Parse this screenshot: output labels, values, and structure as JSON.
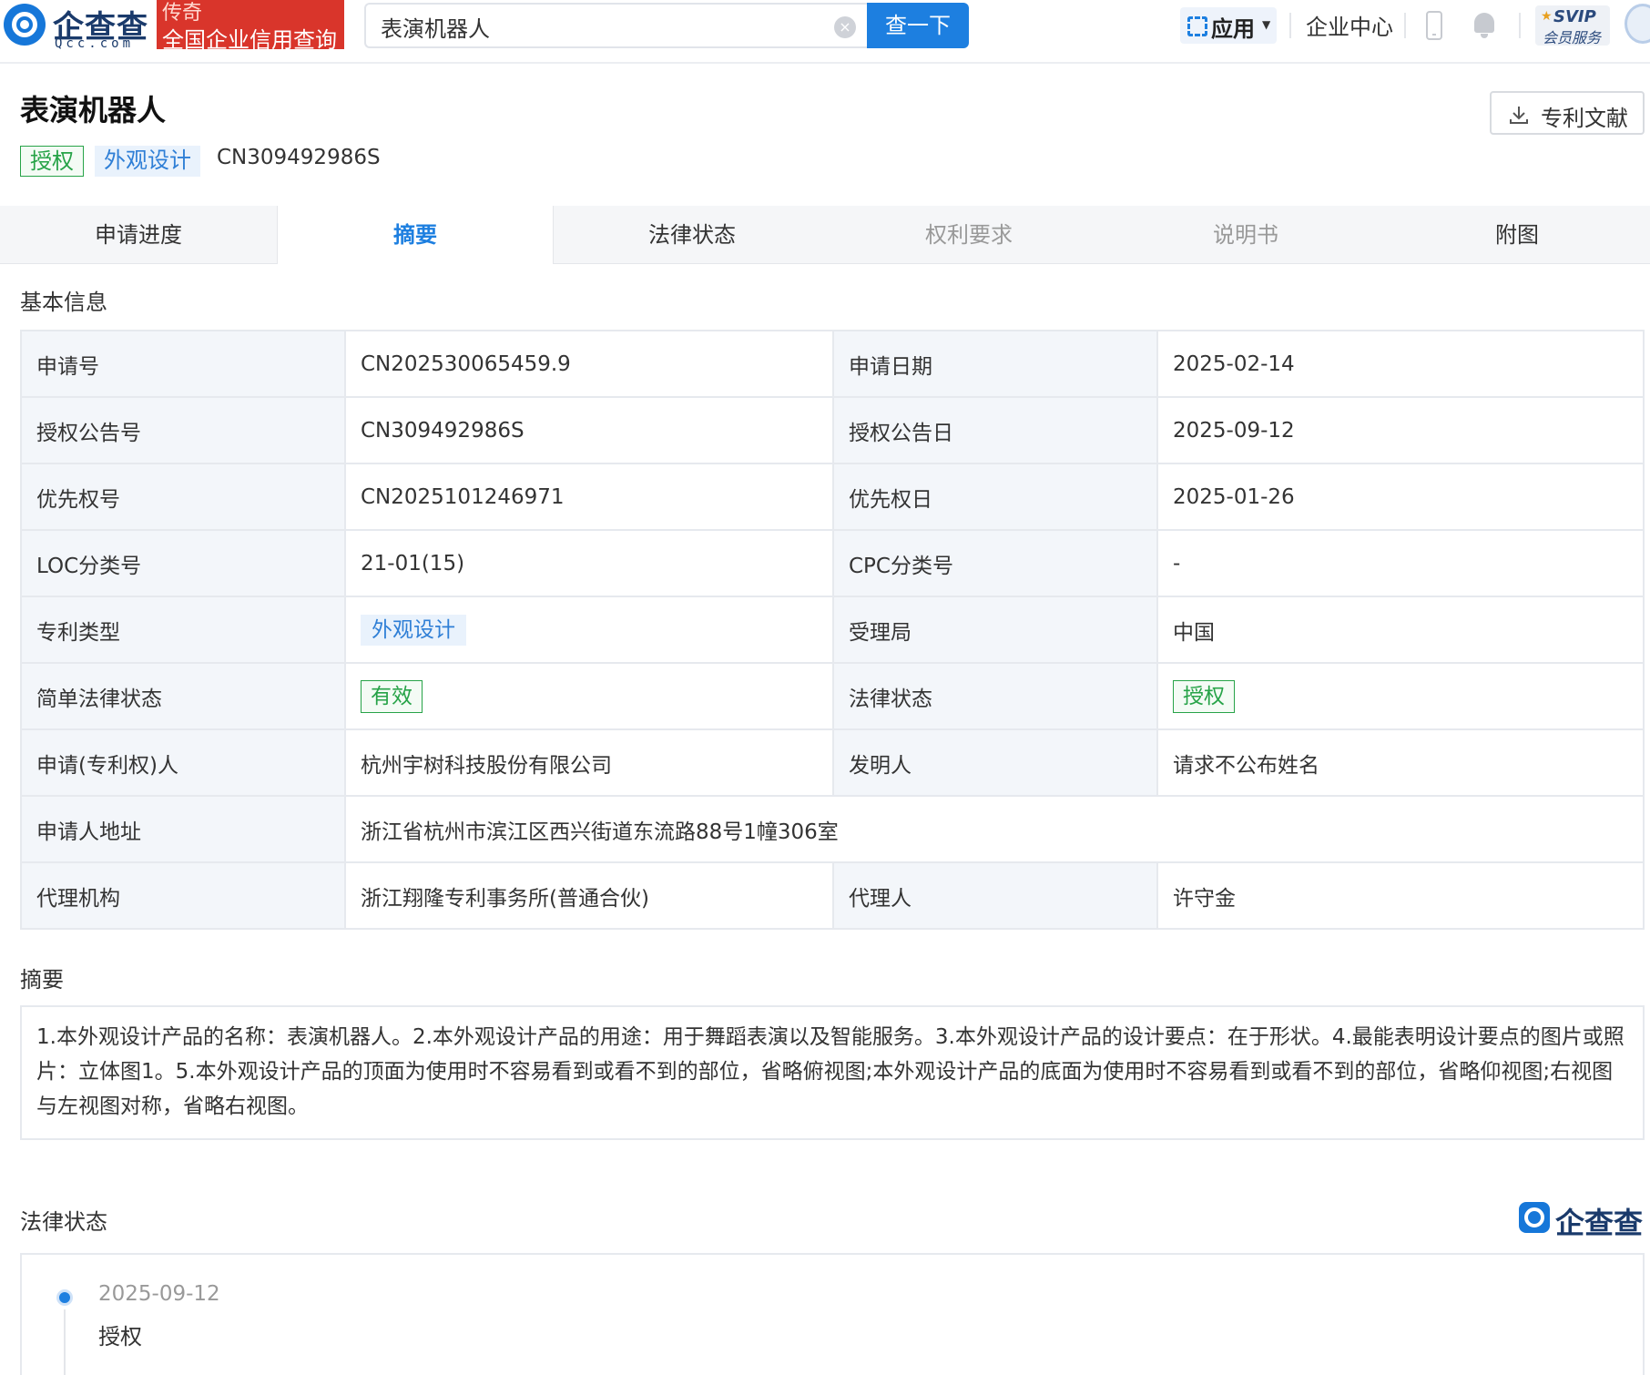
{
  "header": {
    "logo_cn": "企查查",
    "logo_en": "Qcc.com",
    "promo_line1": "传奇",
    "promo_line2": "全国企业信用查询",
    "search_value": "表演机器人",
    "search_button": "查一下",
    "apps_label": "应用",
    "enterprise_center": "企业中心",
    "svip_title": "SVIP",
    "svip_sub": "会员服务"
  },
  "patent": {
    "title": "表演机器人",
    "tags": [
      "授权",
      "外观设计"
    ],
    "publication_no": "CN309492986S",
    "doc_button": "专利文献"
  },
  "tabs": [
    {
      "label": "申请进度",
      "state": "normal"
    },
    {
      "label": "摘要",
      "state": "active"
    },
    {
      "label": "法律状态",
      "state": "normal"
    },
    {
      "label": "权利要求",
      "state": "disabled"
    },
    {
      "label": "说明书",
      "state": "disabled"
    },
    {
      "label": "附图",
      "state": "normal"
    }
  ],
  "basic_info": {
    "section_title": "基本信息",
    "rows": [
      {
        "l1": "申请号",
        "v1": "CN202530065459.9",
        "l2": "申请日期",
        "v2": "2025-02-14"
      },
      {
        "l1": "授权公告号",
        "v1": "CN309492986S",
        "l2": "授权公告日",
        "v2": "2025-09-12"
      },
      {
        "l1": "优先权号",
        "v1": "CN2025101246971",
        "l2": "优先权日",
        "v2": "2025-01-26"
      },
      {
        "l1": "LOC分类号",
        "v1": "21-01(15)",
        "l2": "CPC分类号",
        "v2": "-"
      },
      {
        "l1": "专利类型",
        "v1": "外观设计",
        "l2": "受理局",
        "v2": "中国"
      },
      {
        "l1": "简单法律状态",
        "v1": "有效",
        "l2": "法律状态",
        "v2": "授权"
      },
      {
        "l1": "申请(专利权)人",
        "v1": "杭州宇树科技股份有限公司",
        "l2": "发明人",
        "v2": "请求不公布姓名"
      },
      {
        "l1": "申请人地址",
        "v1": "浙江省杭州市滨江区西兴街道东流路88号1幢306室"
      },
      {
        "l1": "代理机构",
        "v1": "浙江翔隆专利事务所(普通合伙)",
        "l2": "代理人",
        "v2": "许守金"
      }
    ]
  },
  "abstract": {
    "section_title": "摘要",
    "text": "1.本外观设计产品的名称：表演机器人。2.本外观设计产品的用途：用于舞蹈表演以及智能服务。3.本外观设计产品的设计要点：在于形状。4.最能表明设计要点的图片或照片：立体图1。5.本外观设计产品的顶面为使用时不容易看到或看不到的部位，省略俯视图;本外观设计产品的底面为使用时不容易看到或看不到的部位，省略仰视图;右视图与左视图对称，省略右视图。"
  },
  "legal_status": {
    "section_title": "法律状态",
    "brand": "企查查",
    "events": [
      {
        "date": "2025-09-12",
        "event": "授权"
      }
    ]
  }
}
